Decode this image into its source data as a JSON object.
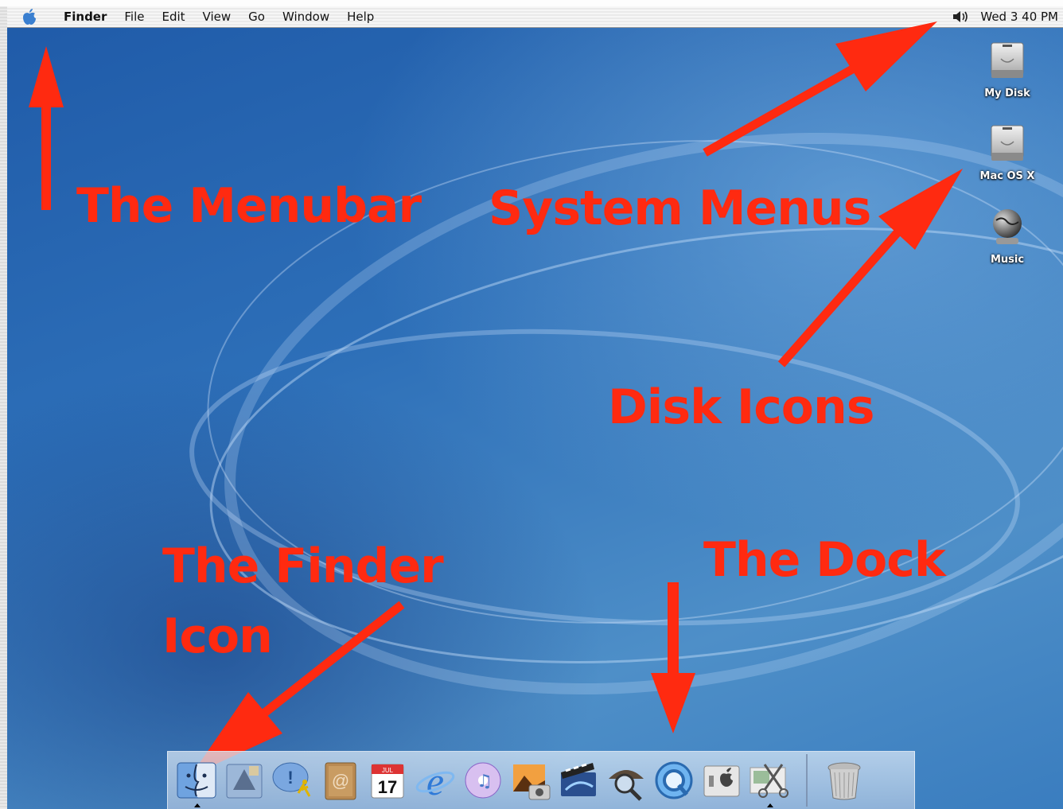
{
  "menubar": {
    "app_name": "Finder",
    "items": [
      "File",
      "Edit",
      "View",
      "Go",
      "Window",
      "Help"
    ],
    "clock": "Wed 3 40 PM",
    "volume_glyph": "🔊"
  },
  "desktop_icons": [
    {
      "label": "My Disk",
      "icon": "hard-disk-icon"
    },
    {
      "label": "Mac OS X",
      "icon": "hard-disk-icon"
    },
    {
      "label": "Music",
      "icon": "network-globe-icon"
    }
  ],
  "annotations": {
    "menubar": "The Menubar",
    "system_menus": "System Menus",
    "disk_icons": "Disk Icons",
    "finder_icon_line1": "The Finder",
    "finder_icon_line2": "Icon",
    "dock": "The Dock"
  },
  "annotation_color": "#ff2a10",
  "dock": {
    "items": [
      {
        "name": "finder-icon",
        "running": true
      },
      {
        "name": "mail-icon",
        "running": false
      },
      {
        "name": "ichat-icon",
        "running": false
      },
      {
        "name": "address-book-icon",
        "running": false
      },
      {
        "name": "ical-icon",
        "running": false,
        "text": "17",
        "month": "JUL"
      },
      {
        "name": "internet-explorer-icon",
        "running": false
      },
      {
        "name": "itunes-icon",
        "running": false
      },
      {
        "name": "iphoto-icon",
        "running": false
      },
      {
        "name": "imovie-icon",
        "running": false
      },
      {
        "name": "sherlock-icon",
        "running": false
      },
      {
        "name": "quicktime-icon",
        "running": false
      },
      {
        "name": "system-preferences-icon",
        "running": false
      },
      {
        "name": "grab-icon",
        "running": true
      }
    ],
    "trash": "trash-icon"
  }
}
